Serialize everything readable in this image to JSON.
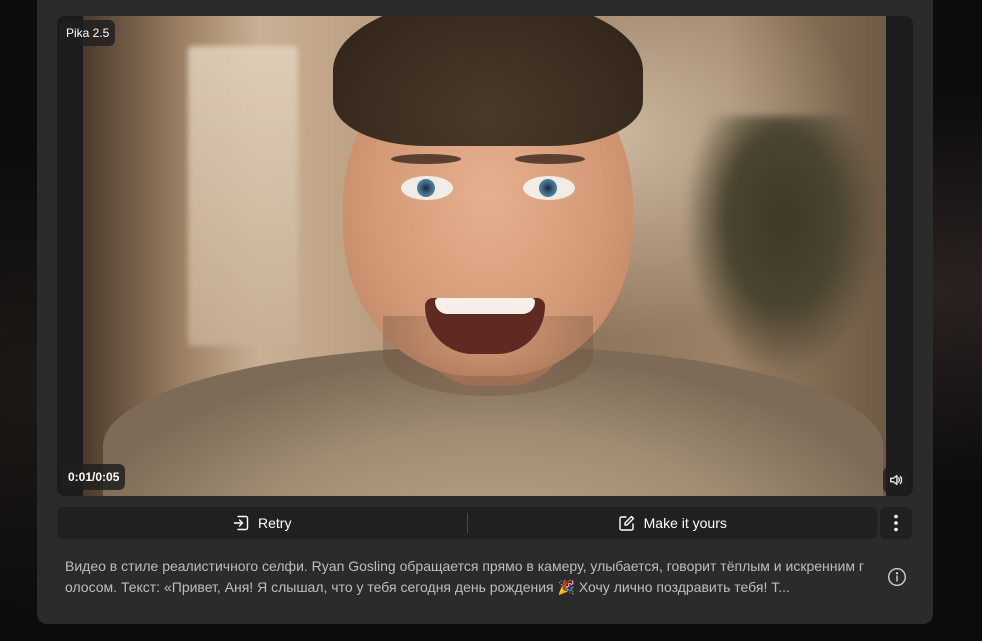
{
  "video": {
    "model_badge": "Pika 2.5",
    "timestamp": "0:01/0:05",
    "volume_icon": "speaker-icon"
  },
  "actions": {
    "retry_label": "Retry",
    "retry_icon": "retry-icon",
    "make_it_yours_label": "Make it yours",
    "make_it_yours_icon": "edit-icon",
    "more_icon": "more-vertical-icon"
  },
  "prompt": {
    "text": "Видео в стиле реалистичного селфи. Ryan Gosling обращается прямо в камеру, улыбается, говорит тёплым и искренним голосом. Текст: «Привет, Аня! Я слышал, что у тебя сегодня день рождения 🎉 Хочу лично поздравить тебя! Т...",
    "info_icon": "info-icon"
  },
  "colors": {
    "card_bg": "#2b2b2b",
    "bar_bg": "#202020",
    "text_primary": "#ffffff",
    "text_secondary": "#bdbdbd"
  }
}
